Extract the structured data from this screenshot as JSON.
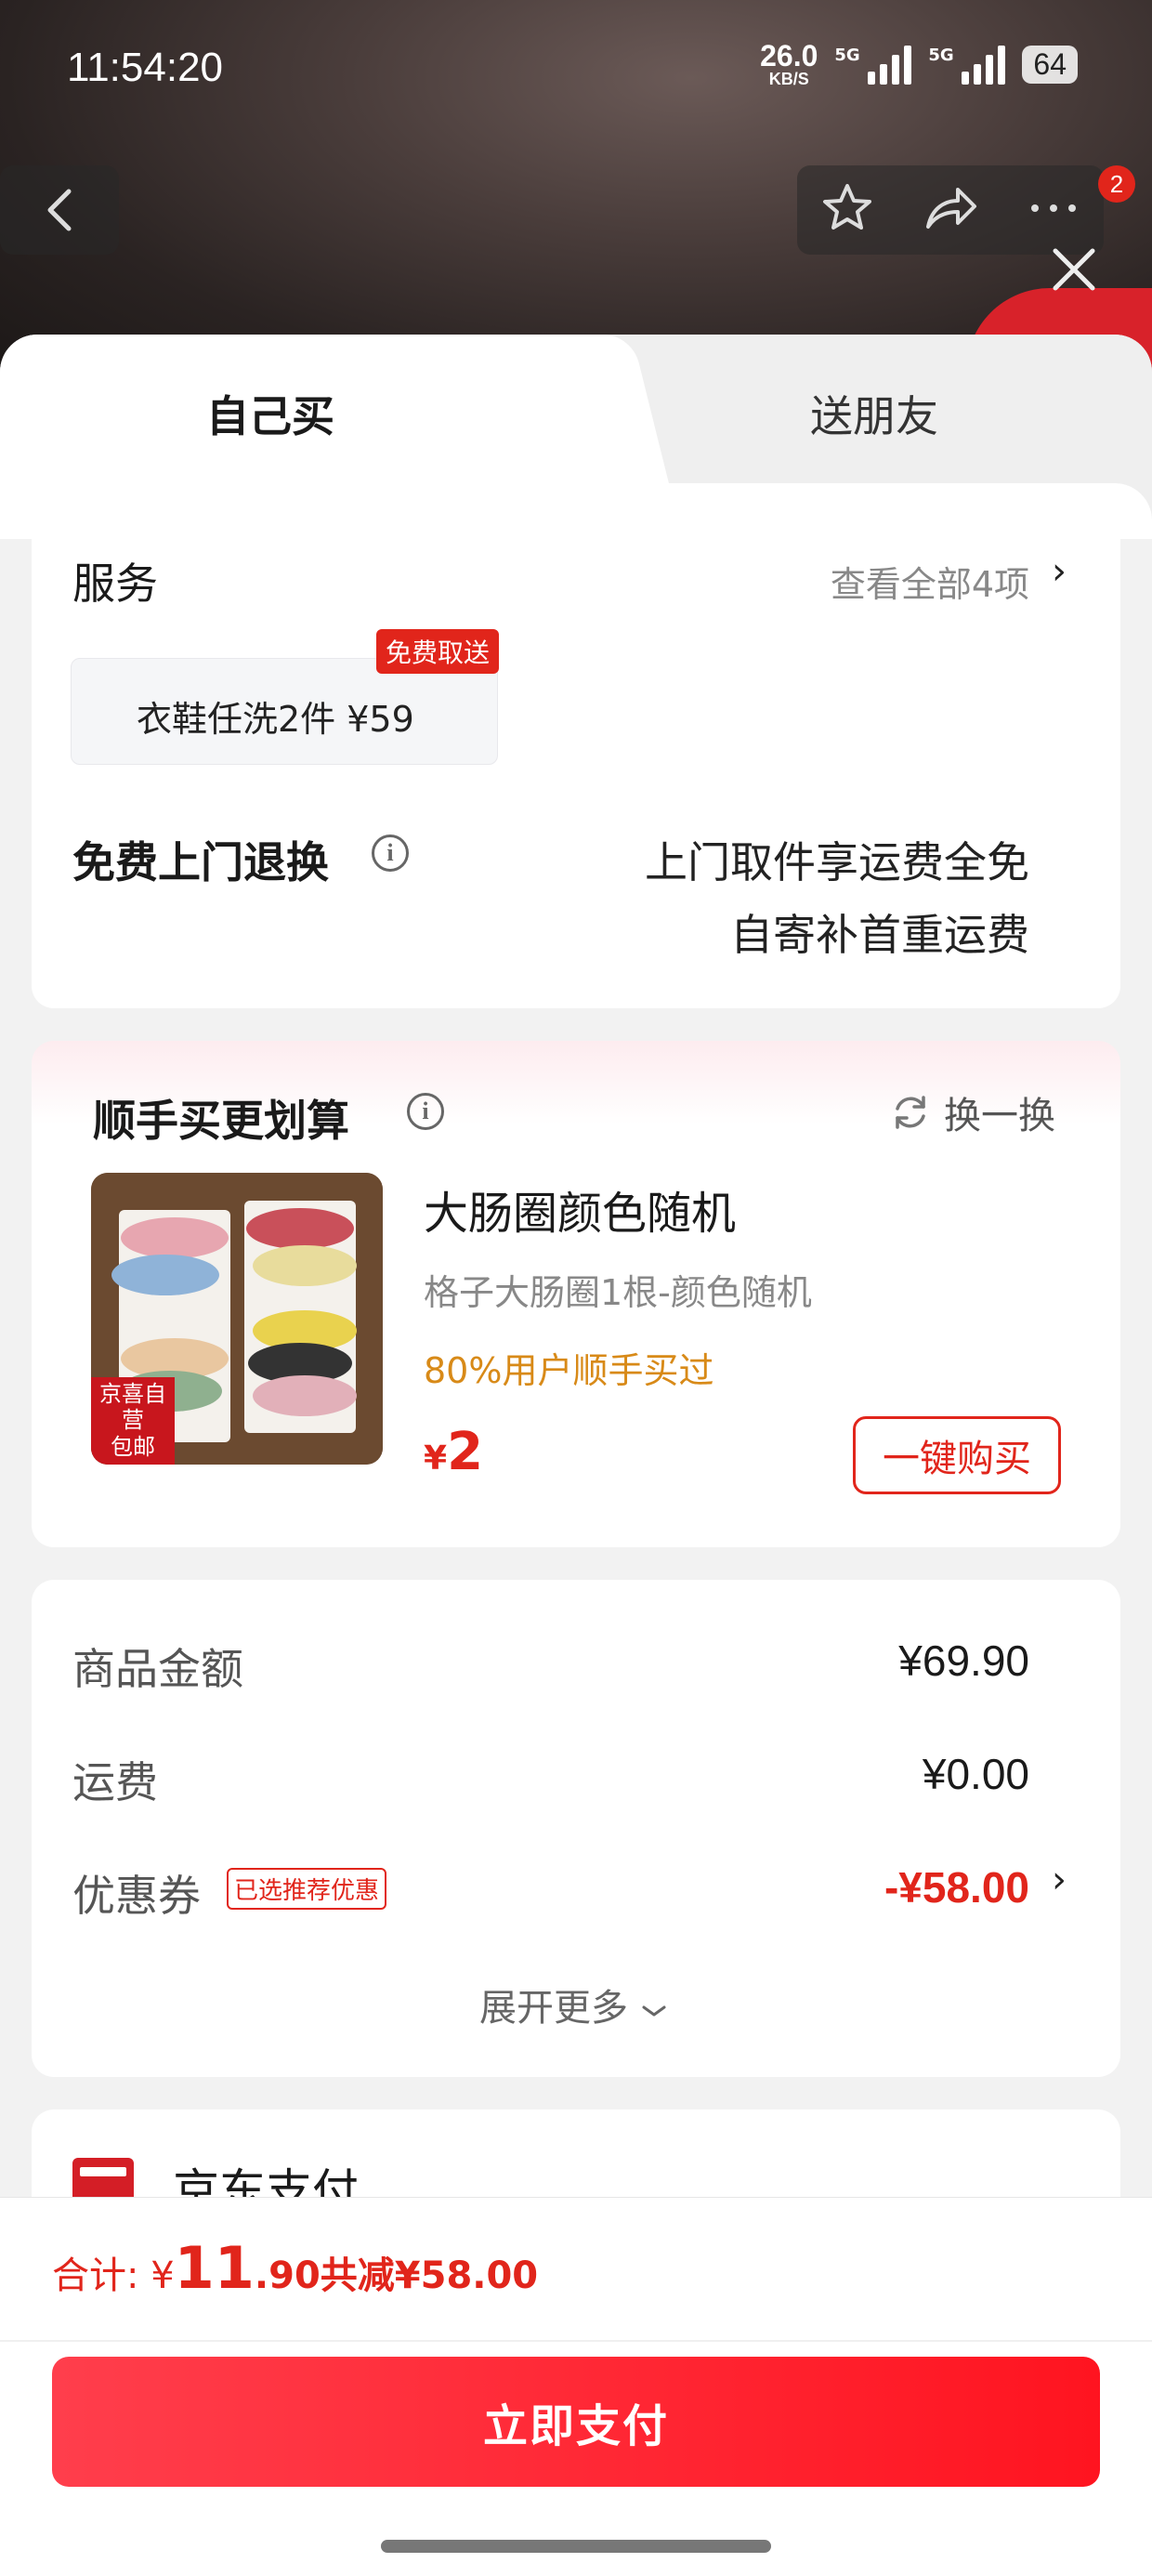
{
  "status_bar": {
    "time": "11:54:20",
    "net_speed": "26.0",
    "net_unit": "KB/S",
    "signal1": "5G",
    "signal2": "5G",
    "battery": "64"
  },
  "nav": {
    "notification_count": "2"
  },
  "tabs": {
    "self": "自己买",
    "friend": "送朋友"
  },
  "service": {
    "title": "服务",
    "view_all": "查看全部4项",
    "chip_text": "衣鞋任洗2件 ¥59",
    "chip_tag": "免费取送",
    "return_title": "免费上门退换",
    "return_line1": "上门取件享运费全免",
    "return_line2": "自寄补首重运费"
  },
  "upsell": {
    "title": "顺手买更划算",
    "swap": "换一换",
    "image_tag_line1": "京喜自营",
    "image_tag_line2": "包邮",
    "product_name": "大肠圈颜色随机",
    "product_desc": "格子大肠圈1根-颜色随机",
    "hint": "80%用户顺手买过",
    "price_currency": "¥",
    "price": "2",
    "buy_button": "一键购买"
  },
  "summary": {
    "goods_label": "商品金额",
    "goods_value": "¥69.90",
    "shipping_label": "运费",
    "shipping_value": "¥0.00",
    "coupon_label": "优惠券",
    "coupon_tag": "已选推荐优惠",
    "coupon_value": "-¥58.00",
    "expand": "展开更多"
  },
  "payment": {
    "method": "京东支付"
  },
  "footer": {
    "total_label": "合计: ¥",
    "total_int": "11",
    "total_dec": ".90",
    "reduced": " 共减¥58.00",
    "pay_button": "立即支付"
  },
  "colors": {
    "accent": "#e1251b",
    "hint": "#d88a18"
  }
}
